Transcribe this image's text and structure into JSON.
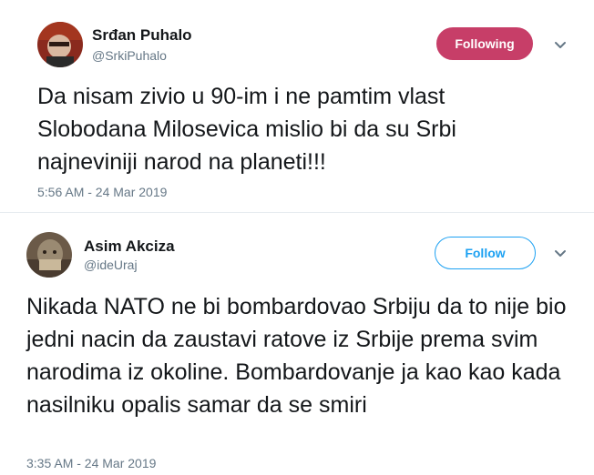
{
  "tweets": [
    {
      "author": {
        "name": "Srđan Puhalo",
        "handle": "@SrkiPuhalo"
      },
      "follow_label": "Following",
      "text": "Da nisam zivio u 90-im i ne pamtim vlast Slobodana Milosevica mislio bi da su Srbi najneviniji narod na planeti!!!",
      "timestamp": "5:56 AM - 24 Mar 2019",
      "colors": {
        "button_bg": "#c73e68"
      }
    },
    {
      "author": {
        "name": "Asim Akciza",
        "handle": "@ideUraj"
      },
      "follow_label": "Follow",
      "text": "Nikada NATO ne bi bombardovao Srbiju da to nije bio jedni nacin da zaustavi ratove iz Srbije prema svim narodima iz okoline. Bombardovanje ja kao kao kada nasilniku opalis samar da se smiri",
      "timestamp": "3:35 AM - 24 Mar 2019",
      "colors": {
        "button_border": "#1da1f2"
      }
    }
  ]
}
